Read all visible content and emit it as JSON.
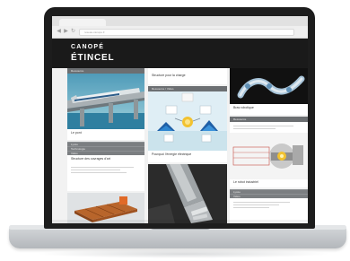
{
  "browser": {
    "back_icon": "back-arrow-icon",
    "forward_icon": "forward-arrow-icon",
    "reload_icon": "reload-icon",
    "url": "reseau-canope.fr"
  },
  "site": {
    "brand": "CANOPÉ",
    "title": "ÉTINCEL"
  },
  "cards": {
    "train": {
      "tag": "Ressource",
      "caption": "Le pont"
    },
    "list_meta": [
      "Lycée",
      "Technologie",
      "Vidéo"
    ],
    "list_text": "Structure des ouvrages d'art",
    "crane": {
      "caption": "Structure pour la charge"
    },
    "energy": {
      "tag": "Ressource / Vidéo",
      "caption": "Pourquoi l'énergie électrique"
    },
    "robot_arm": {
      "caption": "Bras robotique"
    },
    "machine": {
      "tag": "Ressource",
      "caption": "Le robot industriel"
    },
    "robot_meta": [
      "Lycée",
      "Vidéo"
    ]
  },
  "colors": {
    "bezel": "#1d1d1d",
    "header": "#1a1a1a",
    "card_bar": "#6c6f72",
    "accent": "#f2c230"
  }
}
